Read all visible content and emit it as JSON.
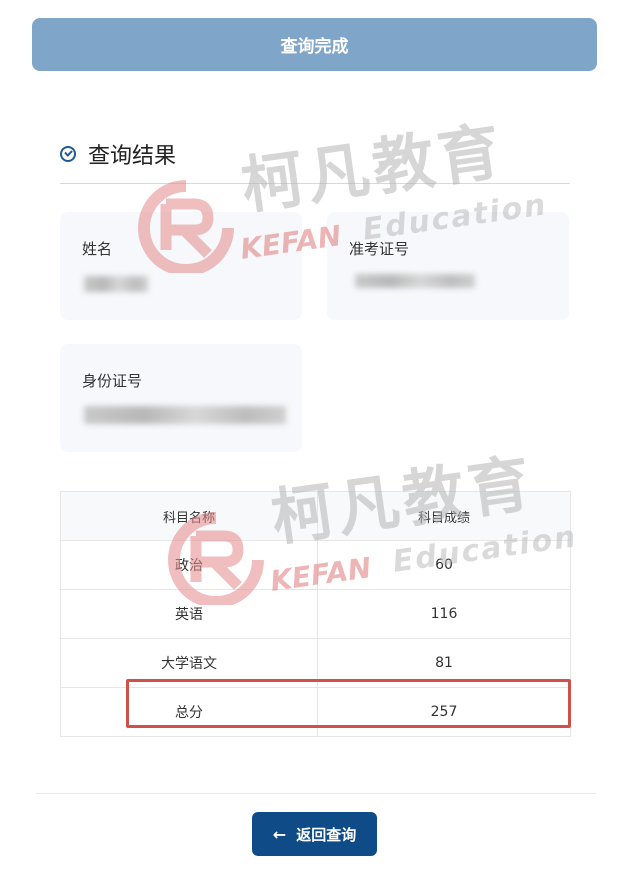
{
  "header": {
    "status_label": "查询完成"
  },
  "results": {
    "title": "查询结果",
    "fields": {
      "name_label": "姓名",
      "exam_id_label": "准考证号",
      "id_number_label": "身份证号"
    }
  },
  "scores": {
    "columns": [
      "科目名称",
      "科目成绩"
    ],
    "rows": [
      {
        "subject": "政治",
        "score": "60"
      },
      {
        "subject": "英语",
        "score": "116"
      },
      {
        "subject": "大学语文",
        "score": "81"
      },
      {
        "subject": "总分",
        "score": "257"
      }
    ]
  },
  "footer": {
    "back_label": "返回查询",
    "back_icon": "arrow-left-icon"
  },
  "watermark": {
    "cn": "柯凡教育",
    "brand": "KEFAN",
    "en": "Education"
  },
  "colors": {
    "top_button": "#7fa5c9",
    "back_button": "#0f4b87",
    "highlight_border": "#d0504a"
  }
}
